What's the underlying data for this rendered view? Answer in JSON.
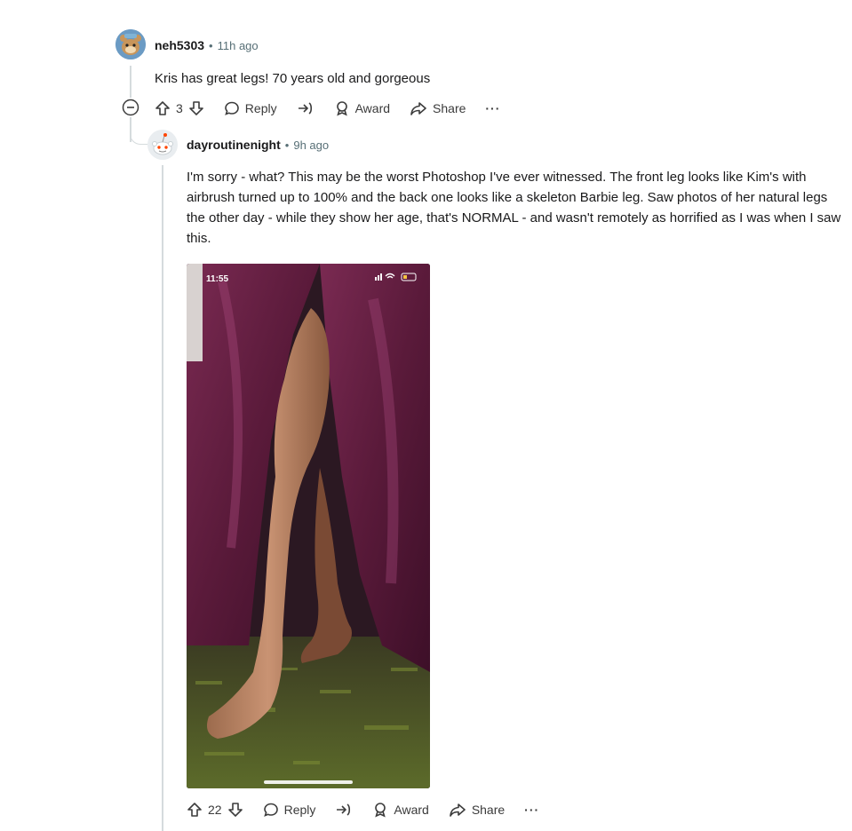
{
  "comment1": {
    "username": "neh5303",
    "separator": "•",
    "time": "11h ago",
    "text": "Kris has great legs! 70 years old and gorgeous",
    "votes": "3",
    "reply_label": "Reply",
    "award_label": "Award",
    "share_label": "Share",
    "more_label": "···"
  },
  "comment2": {
    "username": "dayroutinenight",
    "separator": "•",
    "time": "9h ago",
    "text": "I'm sorry - what? This may be the worst Photoshop I've ever witnessed. The front leg looks like Kim's with airbrush turned up to 100% and the back one looks like a skeleton Barbie leg. Saw photos of her natural legs the other day - while they show her age, that's NORMAL - and wasn't remotely as horrified as I was when I saw this.",
    "image": {
      "status_time": "11:55"
    },
    "votes": "22",
    "reply_label": "Reply",
    "award_label": "Award",
    "share_label": "Share",
    "more_label": "···"
  },
  "icons": [
    "avatar-icon",
    "collapse-icon",
    "upvote-icon",
    "downvote-icon",
    "reply-icon",
    "crosspost-icon",
    "award-icon",
    "share-icon",
    "more-icon",
    "signal-icon",
    "wifi-icon",
    "battery-icon"
  ],
  "colors": {
    "text": "#1a1a1b",
    "meta": "#576f76",
    "thread": "#d5dbdd",
    "dress": "#6b2346"
  }
}
